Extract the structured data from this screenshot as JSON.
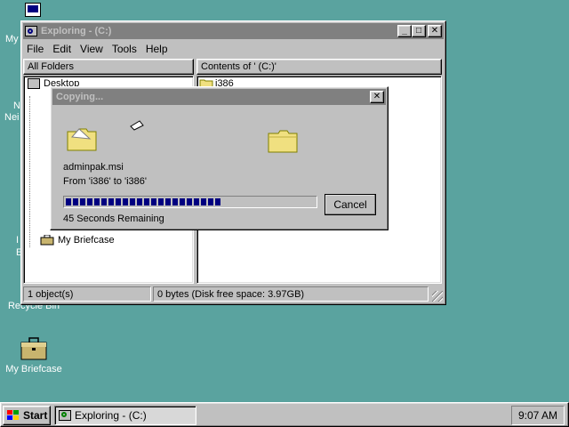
{
  "desktop": {
    "icons": [
      {
        "label": "My",
        "name": "desktop-icon-my-computer"
      },
      {
        "label": "Recycle Bin",
        "name": "desktop-icon-recycle-bin"
      },
      {
        "label": "My Briefcase",
        "name": "desktop-icon-my-briefcase"
      }
    ],
    "partial_labels": [
      "N",
      "Nei",
      "I",
      "E"
    ]
  },
  "explorer": {
    "title": "Exploring -  (C:)",
    "menu": [
      "File",
      "Edit",
      "View",
      "Tools",
      "Help"
    ],
    "all_folders_header": "All Folders",
    "contents_header": "Contents of ' (C:)'",
    "tree": {
      "desktop_label": "Desktop",
      "briefcase_label": "My Briefcase"
    },
    "contents": [
      {
        "label": "i386"
      }
    ],
    "status": {
      "objects": "1 object(s)",
      "disk": "0 bytes (Disk free space: 3.97GB)"
    }
  },
  "copy_dialog": {
    "title": "Copying...",
    "file_name": "adminpak.msi",
    "from_to": "From 'i386' to 'i386'",
    "progress": 0.62,
    "remaining": "45 Seconds Remaining",
    "cancel_label": "Cancel"
  },
  "taskbar": {
    "start_label": "Start",
    "task_label": "Exploring -  (C:)",
    "clock": "9:07 AM"
  },
  "colors": {
    "desktop": "#5aa39f",
    "title_active": "#000080",
    "title_inactive": "#808080",
    "face": "#c0c0c0"
  }
}
